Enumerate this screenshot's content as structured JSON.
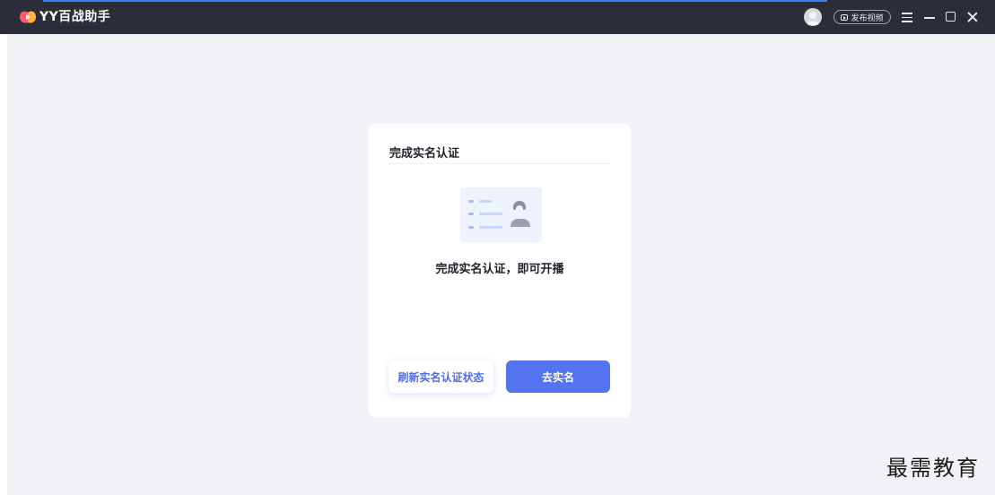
{
  "app": {
    "title": "YY百战助手"
  },
  "header": {
    "publish_label": "发布视频",
    "icons": [
      "logo-icon",
      "avatar",
      "publish-video-icon",
      "menu-icon",
      "minimize-icon",
      "maximize-icon",
      "close-icon"
    ]
  },
  "card": {
    "title": "完成实名认证",
    "message": "完成实名认证，即可开播",
    "refresh_label": "刷新实名认证状态",
    "verify_label": "去实名"
  },
  "watermark": "最需教育",
  "colors": {
    "titlebar": "#2b2e38",
    "accent": "#5473f0",
    "background": "#f1f2f5",
    "card": "#ffffff"
  }
}
